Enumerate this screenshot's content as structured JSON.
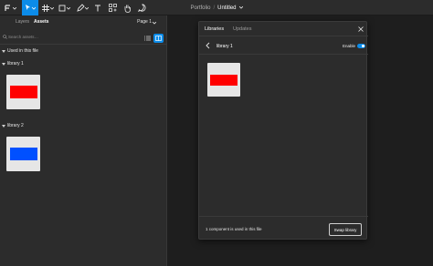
{
  "toolbar": {
    "tools": [
      "main-menu-icon",
      "move-tool-icon",
      "frame-tool-icon",
      "shape-tool-icon",
      "pen-tool-icon",
      "text-tool-icon",
      "resources-icon",
      "hand-tool-icon",
      "comment-tool-icon"
    ],
    "project": "Portfolio",
    "separator": "/",
    "file_name": "Untitled"
  },
  "left_panel": {
    "tabs": [
      {
        "label": "Layers",
        "active": false
      },
      {
        "label": "Assets",
        "active": true
      }
    ],
    "page_select": "Page 1",
    "search_placeholder": "Search assets…",
    "sections": [
      {
        "label": "Used in this file"
      },
      {
        "label": "library 1",
        "swatch_color": "#ff0000"
      },
      {
        "label": "library 2",
        "swatch_color": "#0050ff"
      }
    ]
  },
  "modal": {
    "tabs": [
      {
        "label": "Libraries",
        "active": true
      },
      {
        "label": "Updates",
        "active": false
      }
    ],
    "library_name": "library 1",
    "enable_label": "Enable",
    "enabled": true,
    "component_color": "#ff0000",
    "footer_text": "1 component is used in this file",
    "swap_button": "Swap library"
  },
  "colors": {
    "accent": "#0c8ce9",
    "panel_bg": "#2c2c2c",
    "canvas_bg": "#1e1e1e"
  }
}
